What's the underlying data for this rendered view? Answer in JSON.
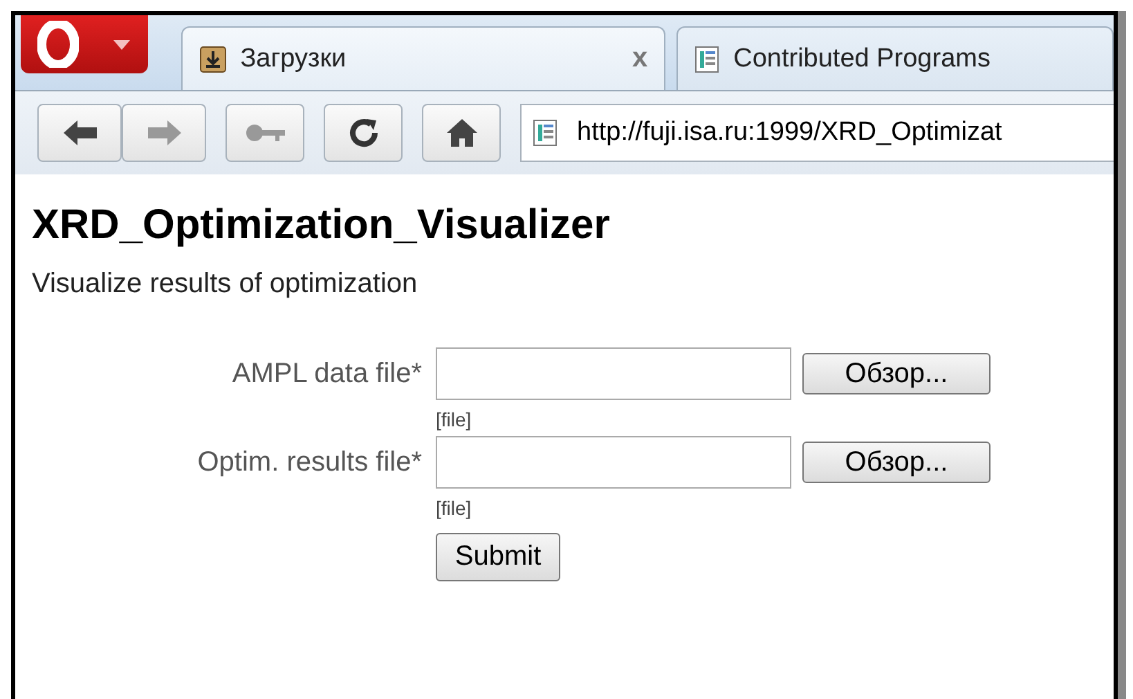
{
  "tabs": [
    {
      "title": "Загрузки",
      "kind": "download",
      "selected": true,
      "close": "x"
    },
    {
      "title": "Contributed Programs",
      "kind": "page",
      "selected": false
    }
  ],
  "address": "http://fuji.isa.ru:1999/XRD_Optimizat",
  "page": {
    "title": "XRD_Optimization_Visualizer",
    "subtitle": "Visualize results of optimization",
    "fields": [
      {
        "label": "AMPL data file*",
        "button": "Обзор...",
        "hint": "[file]"
      },
      {
        "label": "Optim. results file*",
        "button": "Обзор...",
        "hint": "[file]"
      }
    ],
    "submit": "Submit"
  }
}
